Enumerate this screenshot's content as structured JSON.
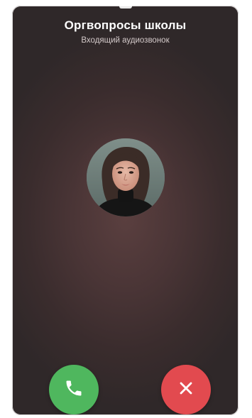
{
  "call": {
    "title": "Оргвопросы школы",
    "subtitle": "Входящий аудиозвонок"
  },
  "actions": {
    "accept_icon": "phone-icon",
    "decline_icon": "close-icon"
  },
  "colors": {
    "accept": "#4fb75e",
    "decline": "#e24a4f",
    "background": "#3a2c2d"
  }
}
